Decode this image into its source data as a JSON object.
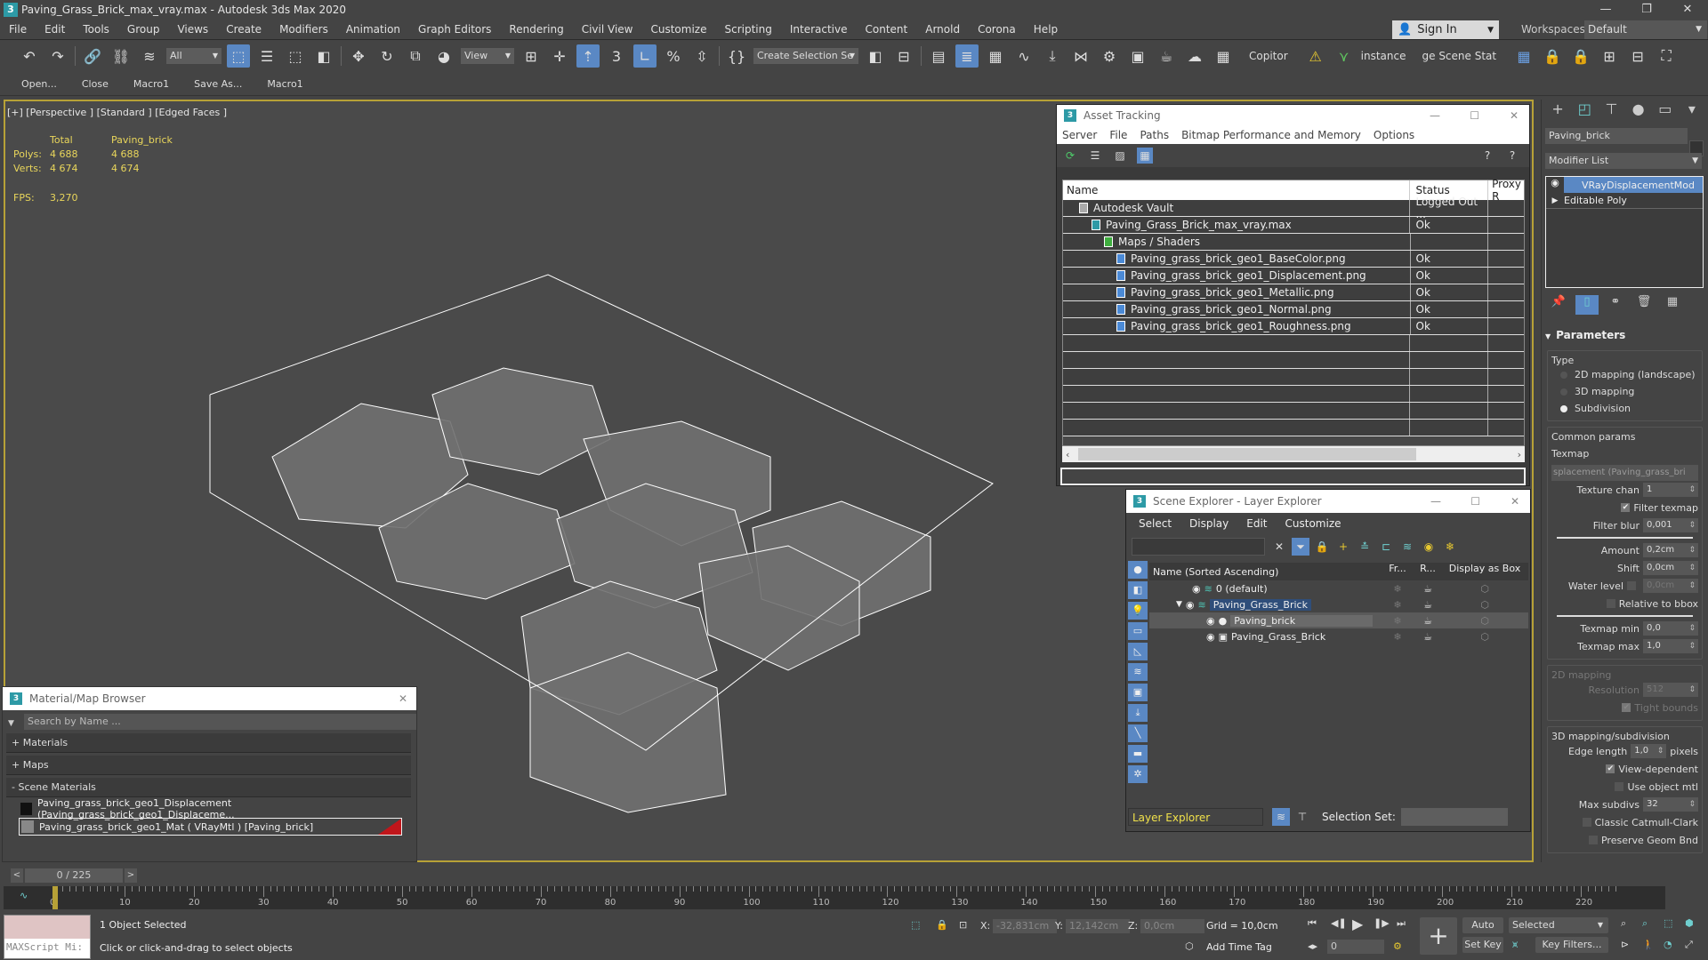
{
  "window": {
    "title": "Paving_Grass_Brick_max_vray.max - Autodesk 3ds Max 2020",
    "app_icon": "3",
    "minimize": "—",
    "restore": "❐",
    "close": "✕"
  },
  "menubar": {
    "items": [
      "File",
      "Edit",
      "Tools",
      "Group",
      "Views",
      "Create",
      "Modifiers",
      "Animation",
      "Graph Editors",
      "Rendering",
      "Civil View",
      "Customize",
      "Scripting",
      "Interactive",
      "Content",
      "Arnold",
      "Corona",
      "Help"
    ],
    "sign_in": "Sign In",
    "workspaces_label": "Workspaces:",
    "workspace_value": "Default"
  },
  "toolbar": {
    "selection_filter": "All",
    "ref_coord": "View",
    "create_selection_set": "Create Selection Se",
    "copitor": "Copitor",
    "instance": "instance",
    "scene_states": "ge Scene Stat"
  },
  "toolbar2": {
    "items": [
      "Open...",
      "Close",
      "Macro1",
      "Save As...",
      "Macro1"
    ]
  },
  "viewport": {
    "label": "[+] [Perspective ] [Standard ] [Edged Faces ]",
    "stats": {
      "col_total": "Total",
      "col_object": "Paving_brick",
      "polys_label": "Polys:",
      "polys_total": "4 688",
      "polys_object": "4 688",
      "verts_label": "Verts:",
      "verts_total": "4 674",
      "verts_object": "4 674",
      "fps_label": "FPS:",
      "fps_value": "3,270"
    }
  },
  "asset_tracking": {
    "title": "Asset Tracking",
    "menu": [
      "Server",
      "File",
      "Paths",
      "Bitmap Performance and Memory",
      "Options"
    ],
    "columns": [
      "Name",
      "Status",
      "Proxy R"
    ],
    "rows": [
      {
        "name": "Autodesk Vault",
        "status": "Logged Out ...",
        "indent": 1,
        "icon": "vault-icon"
      },
      {
        "name": "Paving_Grass_Brick_max_vray.max",
        "status": "Ok",
        "indent": 2,
        "icon": "max-file-icon"
      },
      {
        "name": "Maps / Shaders",
        "status": "",
        "indent": 3,
        "icon": "maps-icon"
      },
      {
        "name": "Paving_grass_brick_geo1_BaseColor.png",
        "status": "Ok",
        "indent": 4,
        "icon": "image-file-icon"
      },
      {
        "name": "Paving_grass_brick_geo1_Displacement.png",
        "status": "Ok",
        "indent": 4,
        "icon": "image-file-icon"
      },
      {
        "name": "Paving_grass_brick_geo1_Metallic.png",
        "status": "Ok",
        "indent": 4,
        "icon": "image-file-icon"
      },
      {
        "name": "Paving_grass_brick_geo1_Normal.png",
        "status": "Ok",
        "indent": 4,
        "icon": "image-file-icon"
      },
      {
        "name": "Paving_grass_brick_geo1_Roughness.png",
        "status": "Ok",
        "indent": 4,
        "icon": "image-file-icon"
      }
    ]
  },
  "scene_explorer": {
    "title": "Scene Explorer - Layer Explorer",
    "menu": [
      "Select",
      "Display",
      "Edit",
      "Customize"
    ],
    "columns": [
      "Name (Sorted Ascending)",
      "Fr...",
      "R...",
      "Display as Box"
    ],
    "rows": [
      {
        "name": "0 (default)",
        "type": "layer"
      },
      {
        "name": "Paving_Grass_Brick",
        "type": "layer",
        "selected": true,
        "expanded": true
      },
      {
        "name": "Paving_brick",
        "type": "object",
        "highlighted": true
      },
      {
        "name": "Paving_Grass_Brick",
        "type": "group"
      }
    ],
    "explorer_type": "Layer Explorer",
    "selection_set_label": "Selection Set:"
  },
  "material_browser": {
    "title": "Material/Map Browser",
    "search_placeholder": "Search by Name ...",
    "groups": [
      "+ Materials",
      "+ Maps",
      "- Scene Materials"
    ],
    "items": [
      "Paving_grass_brick_geo1_Displacement (Paving_grass_brick_geo1_Displaceme...",
      "Paving_grass_brick_geo1_Mat ( VRayMtl ) [Paving_brick]"
    ]
  },
  "command_panel": {
    "object_name": "Paving_brick",
    "modifier_list": "Modifier List",
    "stack": [
      "VRayDisplacementMod",
      "Editable Poly"
    ],
    "parameters_title": "Parameters",
    "type_label": "Type",
    "type_options": [
      "2D mapping (landscape)",
      "3D mapping",
      "Subdivision"
    ],
    "type_selected": "Subdivision",
    "common_params": "Common params",
    "texmap_label": "Texmap",
    "texmap_value": "splacement (Paving_grass_bri",
    "texture_chan_label": "Texture chan",
    "texture_chan": "1",
    "filter_texmap_label": "Filter texmap",
    "filter_texmap": true,
    "filter_blur_label": "Filter blur",
    "filter_blur": "0,001",
    "amount_label": "Amount",
    "amount": "0,2cm",
    "shift_label": "Shift",
    "shift": "0,0cm",
    "water_level_label": "Water level",
    "water_level": "0,0cm",
    "relative_bbox_label": "Relative to bbox",
    "texmap_min_label": "Texmap min",
    "texmap_min": "0,0",
    "texmap_max_label": "Texmap max",
    "texmap_max": "1,0",
    "mapping2d_title": "2D mapping",
    "resolution_label": "Resolution",
    "resolution": "512",
    "tight_bounds_label": "Tight bounds",
    "mapping3d_title": "3D mapping/subdivision",
    "edge_length_label": "Edge length",
    "edge_length": "1,0",
    "edge_units": "pixels",
    "view_dependent_label": "View-dependent",
    "use_object_mtl_label": "Use object mtl",
    "max_subdivs_label": "Max subdivs",
    "max_subdivs": "32",
    "catmull_label": "Classic Catmull-Clark",
    "preserve_label": "Preserve Geom Bnd"
  },
  "timeline": {
    "frame_display": "0 / 225",
    "current_frame": 0,
    "total_frames": 225,
    "tick_labels": [
      "0",
      "10",
      "20",
      "30",
      "40",
      "50",
      "60",
      "70",
      "80",
      "90",
      "100",
      "110",
      "120",
      "130",
      "140",
      "150",
      "160",
      "170",
      "180",
      "190",
      "200",
      "210",
      "220"
    ]
  },
  "statusbar": {
    "maxscript_placeholder": "MAXScript Mi:",
    "selection_status": "1 Object Selected",
    "prompt": "Click or click-and-drag to select objects",
    "x_label": "X:",
    "x_value": "-32,831cm",
    "y_label": "Y:",
    "y_value": "12,142cm",
    "z_label": "Z:",
    "z_value": "0,0cm",
    "grid": "Grid = 10,0cm",
    "add_time_tag": "Add Time Tag",
    "auto_key": "Auto Key",
    "set_key": "Set Key",
    "key_mode": "Selected",
    "key_filters": "Key Filters...",
    "frame_field": "0"
  }
}
